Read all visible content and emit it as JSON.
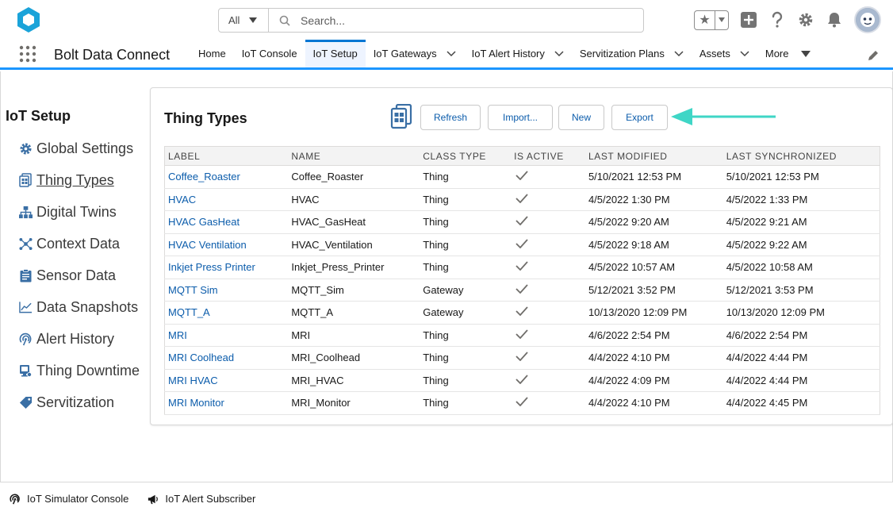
{
  "search": {
    "scope": "All",
    "placeholder": "Search..."
  },
  "app": {
    "name": "Bolt Data Connect"
  },
  "nav": {
    "items": [
      {
        "label": "Home",
        "dropdown": false,
        "active": false
      },
      {
        "label": "IoT Console",
        "dropdown": false,
        "active": false
      },
      {
        "label": "IoT Setup",
        "dropdown": false,
        "active": true
      },
      {
        "label": "IoT Gateways",
        "dropdown": true,
        "active": false
      },
      {
        "label": "IoT Alert History",
        "dropdown": true,
        "active": false
      },
      {
        "label": "Servitization Plans",
        "dropdown": true,
        "active": false
      },
      {
        "label": "Assets",
        "dropdown": true,
        "active": false
      }
    ],
    "more_label": "More"
  },
  "sidebar": {
    "title": "IoT Setup",
    "items": [
      {
        "label": "Global Settings",
        "icon": "gear-icon"
      },
      {
        "label": "Thing Types",
        "icon": "thing-types-icon",
        "active": true
      },
      {
        "label": "Digital Twins",
        "icon": "hierarchy-icon"
      },
      {
        "label": "Context Data",
        "icon": "network-icon"
      },
      {
        "label": "Sensor Data",
        "icon": "clipboard-icon"
      },
      {
        "label": "Data Snapshots",
        "icon": "line-chart-icon"
      },
      {
        "label": "Alert History",
        "icon": "signal-icon"
      },
      {
        "label": "Thing Downtime",
        "icon": "device-icon"
      },
      {
        "label": "Servitization",
        "icon": "tag-icon"
      }
    ]
  },
  "card": {
    "title": "Thing Types",
    "buttons": {
      "refresh": "Refresh",
      "import": "Import...",
      "new": "New",
      "export": "Export"
    }
  },
  "table": {
    "columns": [
      "LABEL",
      "NAME",
      "CLASS TYPE",
      "IS ACTIVE",
      "LAST MODIFIED",
      "LAST SYNCHRONIZED"
    ],
    "rows": [
      {
        "label": "Coffee_Roaster",
        "name": "Coffee_Roaster",
        "class_type": "Thing",
        "is_active": true,
        "last_modified": "5/10/2021 12:53 PM",
        "last_synchronized": "5/10/2021 12:53 PM"
      },
      {
        "label": "HVAC",
        "name": "HVAC",
        "class_type": "Thing",
        "is_active": true,
        "last_modified": "4/5/2022 1:30 PM",
        "last_synchronized": "4/5/2022 1:33 PM"
      },
      {
        "label": "HVAC GasHeat",
        "name": "HVAC_GasHeat",
        "class_type": "Thing",
        "is_active": true,
        "last_modified": "4/5/2022 9:20 AM",
        "last_synchronized": "4/5/2022 9:21 AM"
      },
      {
        "label": "HVAC Ventilation",
        "name": "HVAC_Ventilation",
        "class_type": "Thing",
        "is_active": true,
        "last_modified": "4/5/2022 9:18 AM",
        "last_synchronized": "4/5/2022 9:22 AM"
      },
      {
        "label": "Inkjet Press Printer",
        "name": "Inkjet_Press_Printer",
        "class_type": "Thing",
        "is_active": true,
        "last_modified": "4/5/2022 10:57 AM",
        "last_synchronized": "4/5/2022 10:58 AM"
      },
      {
        "label": "MQTT Sim",
        "name": "MQTT_Sim",
        "class_type": "Gateway",
        "is_active": true,
        "last_modified": "5/12/2021 3:52 PM",
        "last_synchronized": "5/12/2021 3:53 PM"
      },
      {
        "label": "MQTT_A",
        "name": "MQTT_A",
        "class_type": "Gateway",
        "is_active": true,
        "last_modified": "10/13/2020 12:09 PM",
        "last_synchronized": "10/13/2020 12:09 PM"
      },
      {
        "label": "MRI",
        "name": "MRI",
        "class_type": "Thing",
        "is_active": true,
        "last_modified": "4/6/2022 2:54 PM",
        "last_synchronized": "4/6/2022 2:54 PM"
      },
      {
        "label": "MRI Coolhead",
        "name": "MRI_Coolhead",
        "class_type": "Thing",
        "is_active": true,
        "last_modified": "4/4/2022 4:10 PM",
        "last_synchronized": "4/4/2022 4:44 PM"
      },
      {
        "label": "MRI HVAC",
        "name": "MRI_HVAC",
        "class_type": "Thing",
        "is_active": true,
        "last_modified": "4/4/2022 4:09 PM",
        "last_synchronized": "4/4/2022 4:44 PM"
      },
      {
        "label": "MRI Monitor",
        "name": "MRI_Monitor",
        "class_type": "Thing",
        "is_active": true,
        "last_modified": "4/4/2022 4:10 PM",
        "last_synchronized": "4/4/2022 4:45 PM"
      }
    ]
  },
  "utility_bar": {
    "items": [
      {
        "label": "IoT Simulator Console",
        "icon": "signal-icon"
      },
      {
        "label": "IoT Alert Subscriber",
        "icon": "megaphone-icon"
      }
    ]
  },
  "colors": {
    "brand": "#0176d3",
    "link": "#0b5cab",
    "arrow": "#3fd6c6",
    "logo": "#1aa3d9",
    "check": "#706e6b"
  }
}
